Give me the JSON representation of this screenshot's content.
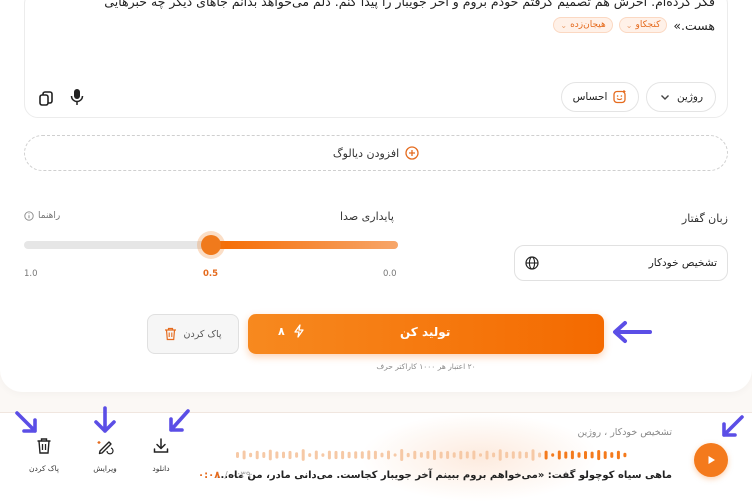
{
  "editor": {
    "line1": "فکر کرده‌ام. آخرش هم تصمیم گرفتم خودم بروم و آخر جویبار را پیدا کنم. دلم می‌خواهد بدانم جاهای دیگر چه خبرهایی",
    "line2": "هست.»",
    "tags": [
      "کنجکاو",
      "هیجان‌زده"
    ],
    "speaker_label": "روژین",
    "emotion_label": "احساس"
  },
  "dialog": {
    "add_label": "افزودن دیالوگ"
  },
  "stability": {
    "label": "پایداری صدا",
    "guide": "راهنما",
    "value": 0.5,
    "min": 0.0,
    "max": 1.0,
    "tick_min": "0.0",
    "tick_mid": "0.5",
    "tick_max": "1.0"
  },
  "language": {
    "label": "زبان گفتار",
    "selected": "تشخیص خودکار"
  },
  "actions": {
    "clear_label": "پاک کردن",
    "generate_label": "تولید کن",
    "cost": "۸",
    "note": "۲۰ اعتبار هر ۱۰۰۰ کاراکتر حرف"
  },
  "player": {
    "meta": "تشخیص خودکار ، روژین",
    "title": "ماهی سیاه کوچولو گفت: «می‌خواهم بروم ببینم آخر جویبار کجاست. می‌دانی مادر، من ماه...",
    "current_time": "۰:۰۸",
    "total_time": "۰:۳۹",
    "download_label": "دانلود",
    "edit_label": "ویرایش",
    "delete_label": "پاک کردن"
  },
  "colors": {
    "accent": "#f47a1c",
    "arrow": "#5b4ee6"
  }
}
